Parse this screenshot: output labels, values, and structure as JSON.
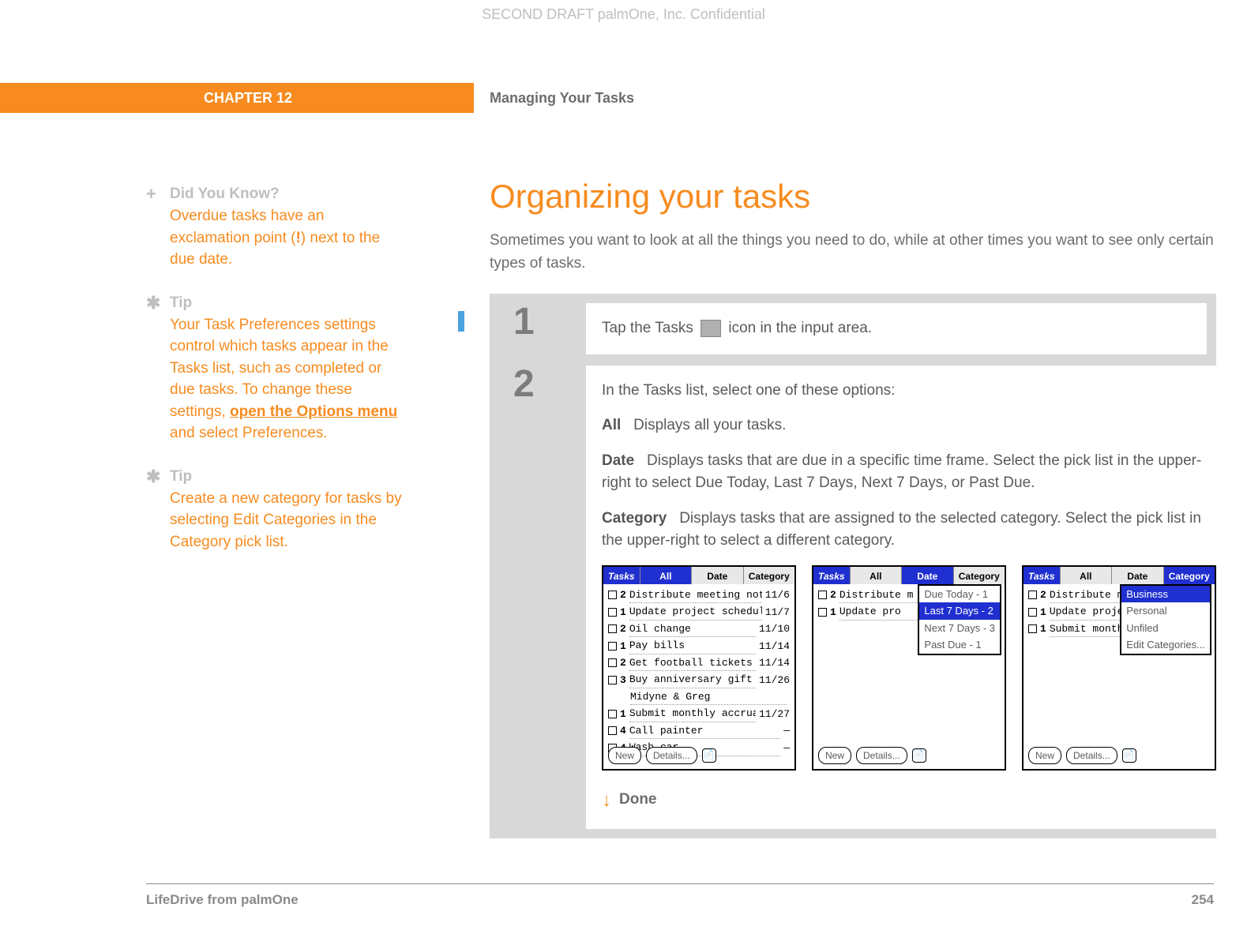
{
  "watermark": "SECOND DRAFT palmOne, Inc.  Confidential",
  "header": {
    "chapter": "CHAPTER 12",
    "title": "Managing Your Tasks"
  },
  "sidebar": {
    "items": [
      {
        "icon": "+",
        "title": "Did You Know?",
        "body_pre": "Overdue tasks have an exclamation point (",
        "body_bold": "!",
        "body_post": ") next to the due date."
      },
      {
        "icon": "✱",
        "title": "Tip",
        "body_pre": "Your Task Preferences settings control which tasks appear in the Tasks list, such as completed or due tasks. To change these settings, ",
        "body_link": "open the Options menu",
        "body_post": " and select Preferences."
      },
      {
        "icon": "✱",
        "title": "Tip",
        "body_pre": "Create a new category for tasks by selecting Edit Categories in the Category pick list.",
        "body_link": "",
        "body_post": ""
      }
    ]
  },
  "main": {
    "heading": "Organizing your tasks",
    "intro": "Sometimes you want to look at all the things you need to do, while at other times you want to see only certain types of tasks.",
    "step1_num": "1",
    "step1_pre": "Tap the Tasks ",
    "step1_post": " icon in the input area.",
    "step2_num": "2",
    "step2_lead": "In the Tasks list, select one of these options:",
    "options": [
      {
        "label": "All",
        "desc": "Displays all your tasks."
      },
      {
        "label": "Date",
        "desc": "Displays tasks that are due in a specific time frame. Select the pick list in the upper-right to select Due Today, Last 7 Days, Next 7 Days, or Past Due."
      },
      {
        "label": "Category",
        "desc": "Displays tasks that are assigned to the selected category. Select the pick list in the upper-right to select a different category."
      }
    ],
    "done": "Done"
  },
  "screenshots": {
    "common": {
      "title": "Tasks",
      "tabs": [
        "All",
        "Date",
        "Category"
      ],
      "new_btn": "New",
      "details_btn": "Details..."
    },
    "shot_all": {
      "rows": [
        {
          "pri": "2",
          "txt": "Distribute meeting notes",
          "date": "11/6"
        },
        {
          "pri": "1",
          "txt": "Update project schedule",
          "date": "11/7"
        },
        {
          "pri": "2",
          "txt": "Oil change",
          "date": "11/10"
        },
        {
          "pri": "1",
          "txt": "Pay bills",
          "date": "11/14"
        },
        {
          "pri": "2",
          "txt": "Get football tickets",
          "date": "11/14"
        },
        {
          "pri": "3",
          "txt": "Buy anniversary gift for",
          "date": "11/26"
        },
        {
          "pri": "",
          "txt": "Midyne & Greg",
          "date": ""
        },
        {
          "pri": "1",
          "txt": "Submit monthly accruals",
          "date": "11/27"
        },
        {
          "pri": "4",
          "txt": "Call painter",
          "date": "—"
        },
        {
          "pri": "4",
          "txt": "Wash car",
          "date": "—"
        }
      ]
    },
    "shot_date": {
      "rows": [
        {
          "pri": "2",
          "txt": "Distribute m",
          "date": ""
        },
        {
          "pri": "1",
          "txt": "Update pro",
          "date": ""
        }
      ],
      "dropdown": [
        "Due Today - 1",
        "Last 7 Days - 2",
        "Next 7 Days - 3",
        "Past Due - 1"
      ],
      "selected": "Last 7 Days - 2"
    },
    "shot_cat": {
      "rows": [
        {
          "pri": "2",
          "txt": "Distribute mee",
          "date": ""
        },
        {
          "pri": "1",
          "txt": "Update projec",
          "date": ""
        },
        {
          "pri": "1",
          "txt": "Submit monthl",
          "date": ""
        }
      ],
      "dropdown": [
        "Business",
        "Personal",
        "Unfiled",
        "Edit Categories..."
      ],
      "selected": "Business"
    }
  },
  "footer": {
    "product": "LifeDrive from palmOne",
    "page": "254"
  }
}
